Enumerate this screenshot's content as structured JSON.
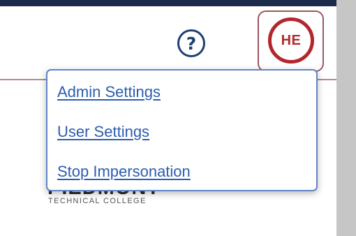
{
  "header": {
    "help_icon_glyph": "?",
    "help_icon_name": "question-circle-icon",
    "avatar_initials": "HE"
  },
  "brand": {
    "name": "PIEDMONT",
    "subtitle": "TECHNICAL COLLEGE"
  },
  "user_menu": {
    "items": [
      {
        "label": "Admin Settings"
      },
      {
        "label": "User Settings"
      },
      {
        "label": "Stop Impersonation"
      }
    ]
  },
  "colors": {
    "top_bar": "#1b2a4a",
    "link": "#2c5db0",
    "menu_border": "#5f86c5",
    "avatar_ring": "#b3262d",
    "help_icon": "#1f3f73",
    "divider": "#b7868a"
  }
}
